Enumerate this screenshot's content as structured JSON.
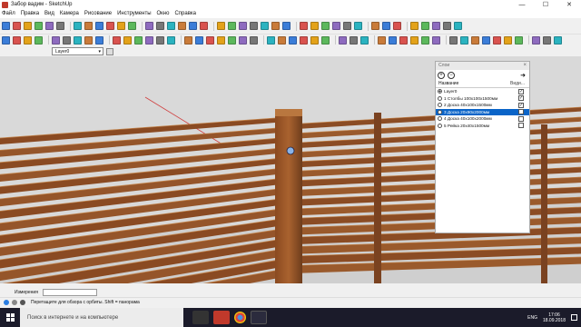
{
  "window": {
    "title": "Забор вадим - SketchUp",
    "minimize_glyph": "—",
    "maximize_glyph": "☐",
    "close_glyph": "✕"
  },
  "menu": [
    "Файл",
    "Правка",
    "Вид",
    "Камера",
    "Рисование",
    "Инструменты",
    "Окно",
    "Справка"
  ],
  "toolbar1_icons": [
    "select-icon",
    "eraser-icon",
    "paint-icon",
    "rectangle-icon",
    "pencil-icon",
    "arc-icon",
    "pushpull-icon",
    "followme-icon",
    "offset-icon",
    "move-icon",
    "rotate-icon",
    "scale-icon",
    "tape-icon",
    "dimension-icon",
    "protractor-icon",
    "text-icon",
    "axes-icon",
    "section-icon",
    "orbit-icon",
    "pan-icon",
    "zoom-icon",
    "zoomwindow-icon",
    "zoomextents-icon",
    "previous-icon",
    "next-icon",
    "top-view-icon",
    "iso-view-icon",
    "front-view-icon",
    "position-camera-icon",
    "walk-icon",
    "lookaround-icon",
    "sandbox-icon",
    "warehouse-icon",
    "extension-icon",
    "component-icon",
    "layers-icon",
    "style-icon",
    "shadow-icon",
    "fog-icon"
  ],
  "toolbar2_icons": [
    "select-icon",
    "paint-icon",
    "eraser-icon",
    "pencil-icon",
    "line-icon",
    "arc-icon",
    "circle-icon",
    "polygon-icon",
    "freehand-icon",
    "pushpull-icon",
    "move-icon",
    "rotate-icon",
    "scale-icon",
    "offset-icon",
    "followme-icon",
    "tape-icon",
    "dimension-icon",
    "protractor-icon",
    "text-icon",
    "axes-icon",
    "3dtext-icon",
    "section-icon",
    "orbit-icon",
    "pan-icon",
    "zoom-icon",
    "zoomwindow-icon",
    "zoomextents-icon",
    "previous-icon",
    "camera-icon",
    "walk-icon",
    "lookaround-icon",
    "xray-icon",
    "wireframe-icon",
    "hiddenline-icon",
    "shaded-icon",
    "textured-icon",
    "monochrome-icon",
    "iso-icon",
    "top-icon",
    "front-icon",
    "right-icon",
    "back-icon",
    "left-icon",
    "bottom-icon",
    "warehouse-icon",
    "shareinfo-icon",
    "extension-icon"
  ],
  "layer_toolbar": {
    "current_layer": "Layer0"
  },
  "layers_panel": {
    "header": "Слои",
    "columns": {
      "name": "Название",
      "visible": "Види..."
    },
    "add_glyph": "+",
    "remove_glyph": "−",
    "detail_glyph": "➜",
    "rows": [
      {
        "name": "Layer0",
        "active": true,
        "visible": true,
        "selected": false
      },
      {
        "name": "1 Столбы 100х100х1500мм",
        "active": false,
        "visible": true,
        "selected": false
      },
      {
        "name": "2 Доска 40х100х1500мм",
        "active": false,
        "visible": true,
        "selected": false
      },
      {
        "name": "3 Доска 20х90х2000мм",
        "active": false,
        "visible": true,
        "selected": true
      },
      {
        "name": "4 Доска 40х100х2000мм",
        "active": false,
        "visible": false,
        "selected": false
      },
      {
        "name": "5 Рейка 20х40х1500мм",
        "active": false,
        "visible": false,
        "selected": false
      }
    ]
  },
  "measurements": {
    "label": "Измерения"
  },
  "status": {
    "hint": "Перетащите для обзора с орбиты.  Shift = панорама"
  },
  "taskbar": {
    "search_placeholder": "Поиск в интернете и на компьютере",
    "language": "ENG",
    "time": "17:06",
    "date": "18.09.2018"
  },
  "colors": {
    "viewport_bg": "#d9d9d9",
    "wood_dark": "#6e3d1c",
    "wood_mid": "#95552a",
    "wood_light": "#b9773f",
    "selection": "#0a64c8",
    "taskbar": "#1b1b2a"
  }
}
